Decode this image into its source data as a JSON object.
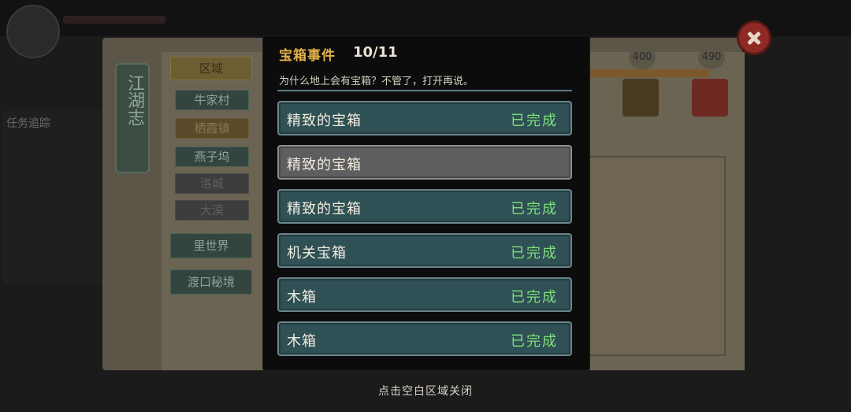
{
  "background": {
    "plaque_text": "江湖志",
    "region_tab": "区域",
    "regions": [
      "牛家村",
      "栖霞镇",
      "燕子坞",
      "洛城",
      "大漠"
    ],
    "other_tabs": [
      "里世界",
      "渡口秘境"
    ],
    "scores": [
      "400",
      "490"
    ],
    "left_log_title": "任务追踪"
  },
  "modal": {
    "title": "宝箱事件",
    "count": "10/11",
    "description": "为什么地上会有宝箱？不管了，打开再说。",
    "items": [
      {
        "name": "精致的宝箱",
        "status": "已完成",
        "completed": true
      },
      {
        "name": "精致的宝箱",
        "status": "",
        "completed": false
      },
      {
        "name": "精致的宝箱",
        "status": "已完成",
        "completed": true
      },
      {
        "name": "机关宝箱",
        "status": "已完成",
        "completed": true
      },
      {
        "name": "木箱",
        "status": "已完成",
        "completed": true
      },
      {
        "name": "木箱",
        "status": "已完成",
        "completed": true
      }
    ]
  },
  "footer_hint": "点击空白区域关闭",
  "colors": {
    "title_gold": "#e3b24a",
    "completed_green": "#7fe07a",
    "item_teal": "#2f5055",
    "item_gray": "#5e5e5e"
  }
}
